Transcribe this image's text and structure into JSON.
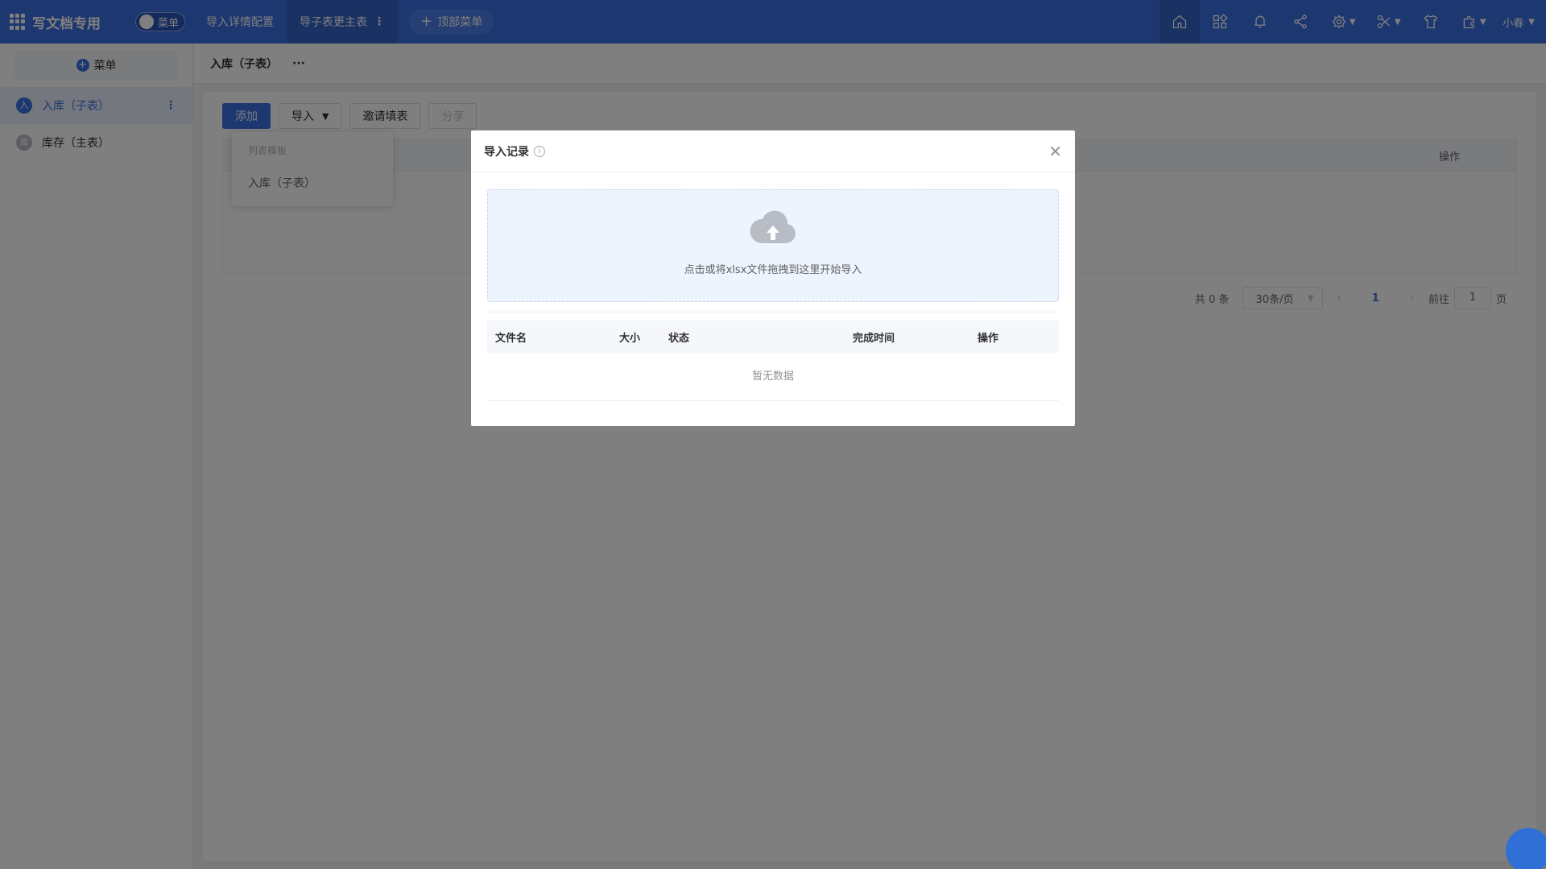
{
  "topbar": {
    "app_title": "写文档专用",
    "toggle_label": "菜单",
    "nav": [
      {
        "label": "导入详情配置"
      },
      {
        "label": "导子表更主表"
      }
    ],
    "top_menu_label": "顶部菜单",
    "user_name": "小春"
  },
  "sidebar": {
    "add_label": "菜单",
    "items": [
      {
        "label": "入库（子表）",
        "avatar": "入"
      },
      {
        "label": "库存（主表）",
        "avatar": "库"
      }
    ]
  },
  "breadcrumb": {
    "title": "入库（子表）",
    "more": "···"
  },
  "toolbar": {
    "add": "添加",
    "import": "导入",
    "invite": "邀请填表",
    "share": "分享"
  },
  "dropdown": {
    "group": "列表模板",
    "item": "入库（子表）"
  },
  "table": {
    "ops_header": "操作"
  },
  "pager": {
    "total": "共 0 条",
    "size": "30条/页",
    "current_page": "1",
    "goto_prefix": "前往",
    "goto_value": "1",
    "goto_suffix": "页"
  },
  "dialog": {
    "title": "导入记录",
    "drop_text": "点击或将xlsx文件拖拽到这里开始导入",
    "columns": [
      "文件名",
      "大小",
      "状态",
      "完成时间",
      "操作"
    ],
    "empty": "暂无数据"
  },
  "colors": {
    "primary": "#3b6fe0",
    "overlay": "rgba(0,0,0,0.5)"
  }
}
